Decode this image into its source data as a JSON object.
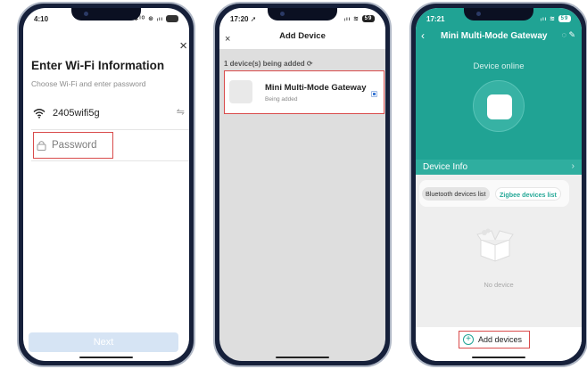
{
  "screen1": {
    "status": {
      "time": "4:10",
      "icons": "✱ᴵᴼ ⊛ ᵢₗₗ"
    },
    "close_icon": "×",
    "title": "Enter Wi-Fi Information",
    "subtitle": "Choose Wi-Fi and enter password",
    "wifi_name": "2405wifi5g",
    "switch_icon": "⇋",
    "password_placeholder": "Password",
    "lock_icon": "🔒",
    "next_label": "Next"
  },
  "screen2": {
    "status": {
      "time": "17:20 ➚",
      "icons": "ᵢₗₗ ≋",
      "battery": "59"
    },
    "close_icon": "×",
    "title": "Add Device",
    "adding_label": "1 device(s) being added ⟳",
    "device": {
      "name": "Mini Multi-Mode Gateway",
      "status": "Being added"
    }
  },
  "screen3": {
    "status": {
      "time": "17:21",
      "icons": "ᵢₗₗ ≋",
      "battery": "59"
    },
    "back_icon": "‹",
    "title": "Mini Multi-Mode Gateway",
    "header_icons": "◌ ✎",
    "online_text": "Device online",
    "device_info_label": "Device Info",
    "device_info_arrow": "›",
    "tabs": [
      "Bluetooth devices list",
      "Zigbee devices list"
    ],
    "empty_text": "No device",
    "add_label": "Add devices",
    "add_icon": "+"
  },
  "colors": {
    "accent_teal": "#20a394",
    "highlight_red": "#d94b4b",
    "next_disabled": "#d6e4f4"
  }
}
